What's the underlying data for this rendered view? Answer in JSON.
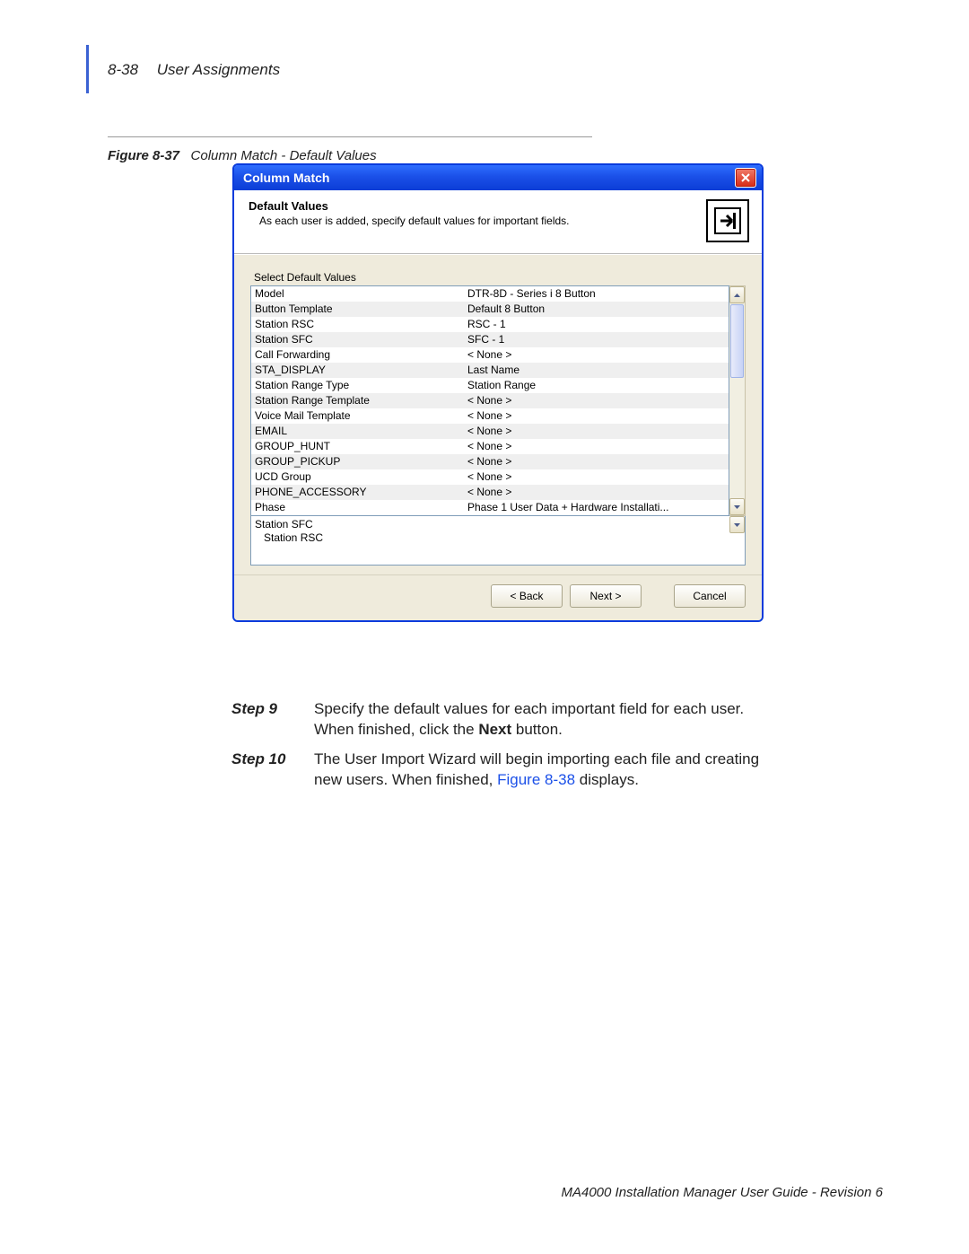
{
  "header": {
    "page_num": "8-38",
    "section": "User Assignments"
  },
  "figure_caption": {
    "label": "Figure 8-37",
    "text": "Column Match - Default Values"
  },
  "window": {
    "title": "Column Match",
    "section_heading": "Default Values",
    "section_desc": "As each user is added, specify default values for important fields.",
    "panel_label": "Select Default Values",
    "rows": [
      {
        "k": "Model",
        "v": "DTR-8D - Series i  8 Button"
      },
      {
        "k": "Button Template",
        "v": "Default 8 Button"
      },
      {
        "k": "Station RSC",
        "v": "RSC - 1"
      },
      {
        "k": "Station SFC",
        "v": "SFC - 1"
      },
      {
        "k": "Call Forwarding",
        "v": "< None >"
      },
      {
        "k": "STA_DISPLAY",
        "v": "Last Name"
      },
      {
        "k": "Station Range Type",
        "v": "Station Range"
      },
      {
        "k": "Station Range Template",
        "v": "< None >"
      },
      {
        "k": "Voice Mail Template",
        "v": "< None >"
      },
      {
        "k": "EMAIL",
        "v": "< None >"
      },
      {
        "k": "GROUP_HUNT",
        "v": "< None >"
      },
      {
        "k": "GROUP_PICKUP",
        "v": "< None >"
      },
      {
        "k": "UCD Group",
        "v": "< None >"
      },
      {
        "k": "PHONE_ACCESSORY",
        "v": "< None >"
      },
      {
        "k": "Phase",
        "v": "Phase 1 User Data + Hardware Installati..."
      }
    ],
    "detail1": "Station SFC",
    "detail2": "Station RSC",
    "buttons": {
      "back": "< Back",
      "next": "Next >",
      "cancel": "Cancel"
    }
  },
  "step9": {
    "label": "Step 9",
    "text_a": "Specify the default values for each important field for each user. When finished, click the ",
    "bold": "Next",
    "text_b": " button."
  },
  "step10": {
    "label": "Step 10",
    "text_a": "The User Import Wizard will begin importing each file and creating new users. When finished, ",
    "link": "Figure 8-38",
    "text_b": " displays."
  },
  "footer": "MA4000 Installation Manager User Guide - Revision 6"
}
